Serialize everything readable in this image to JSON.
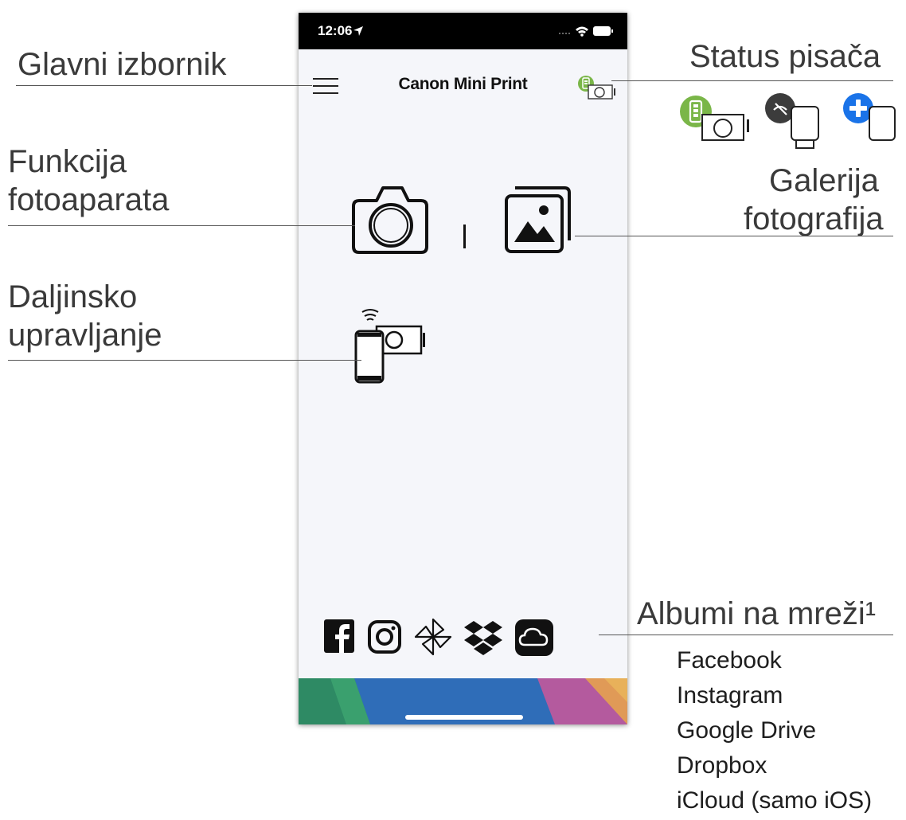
{
  "phone": {
    "status_time": "12:06",
    "title": "Canon Mini Print"
  },
  "callouts": {
    "main_menu": "Glavni izbornik",
    "printer_status": "Status pisača",
    "camera_function": [
      "Funkcija",
      "fotoaparata"
    ],
    "photo_gallery": [
      "Galerija",
      "fotografija"
    ],
    "remote_control": [
      "Daljinsko",
      "upravljanje"
    ],
    "online_albums": "Albumi na mreži¹"
  },
  "online_albums_list": [
    "Facebook",
    "Instagram",
    "Google Drive",
    "Dropbox",
    "iCloud (samo iOS)"
  ],
  "icons": {
    "menu": "hamburger-menu-icon",
    "status": "printer-battery-status-icon",
    "status_variants": [
      "printer-connected-battery-icon",
      "printer-disconnected-icon",
      "add-printer-icon"
    ],
    "camera": "camera-icon",
    "gallery": "photo-gallery-icon",
    "remote": "remote-camera-icon",
    "albums": [
      "facebook-icon",
      "instagram-icon",
      "google-drive-icon",
      "dropbox-icon",
      "icloud-icon"
    ]
  },
  "colors": {
    "battery_green": "#7ab648",
    "add_blue": "#1a73e8",
    "disconnect_gray": "#3c3c3c",
    "phone_bg": "#f5f6fa"
  }
}
